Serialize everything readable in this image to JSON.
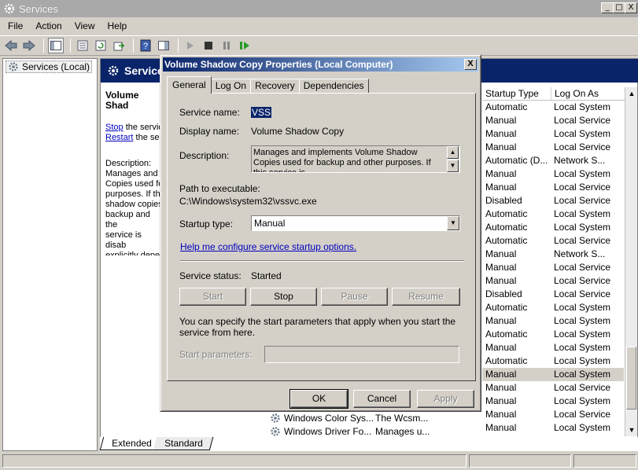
{
  "window": {
    "title": "Services",
    "controls": {
      "minimize": "_",
      "restore": "□",
      "close": "X"
    }
  },
  "menu": [
    "File",
    "Action",
    "View",
    "Help"
  ],
  "tree": {
    "root_label": "Services (Local)"
  },
  "right_pane": {
    "header_title": "Service",
    "description_title": "Volume Shad",
    "stop_link": "Stop",
    "stop_rest": " the servic",
    "restart_link": "Restart",
    "restart_rest": " the se",
    "description_label": "Description:",
    "description_text": "Manages and i\nCopies used fo\npurposes. If th\nshadow copies\nbackup and the\nservice is disab\nexplicitly depe"
  },
  "columns": {
    "startup_type": "Startup Type",
    "log_on_as": "Log On As"
  },
  "services": [
    {
      "startup": "Automatic",
      "logon": "Local System"
    },
    {
      "startup": "Manual",
      "logon": "Local Service"
    },
    {
      "startup": "Manual",
      "logon": "Local System"
    },
    {
      "startup": "Manual",
      "logon": "Local Service"
    },
    {
      "startup": "Automatic (D...",
      "logon": "Network S..."
    },
    {
      "startup": "Manual",
      "logon": "Local System"
    },
    {
      "startup": "Manual",
      "logon": "Local Service"
    },
    {
      "startup": "Disabled",
      "logon": "Local Service"
    },
    {
      "startup": "Automatic",
      "logon": "Local System"
    },
    {
      "startup": "Automatic",
      "logon": "Local System"
    },
    {
      "startup": "Automatic",
      "logon": "Local Service"
    },
    {
      "startup": "Manual",
      "logon": "Network S..."
    },
    {
      "startup": "Manual",
      "logon": "Local Service"
    },
    {
      "startup": "Manual",
      "logon": "Local Service"
    },
    {
      "startup": "Disabled",
      "logon": "Local Service"
    },
    {
      "startup": "Automatic",
      "logon": "Local System"
    },
    {
      "startup": "Manual",
      "logon": "Local System"
    },
    {
      "startup": "Automatic",
      "logon": "Local System"
    },
    {
      "startup": "Manual",
      "logon": "Local System"
    },
    {
      "startup": "Automatic",
      "logon": "Local System"
    },
    {
      "startup": "Manual",
      "logon": "Local System"
    },
    {
      "startup": "Manual",
      "logon": "Local Service"
    },
    {
      "startup": "Manual",
      "logon": "Local System"
    },
    {
      "startup": "Manual",
      "logon": "Local Service"
    },
    {
      "startup": "Manual",
      "logon": "Local System"
    }
  ],
  "selected_service_index": 20,
  "bottom_rows": [
    {
      "name": "Windows Color Sys...",
      "desc": "The Wcsm..."
    },
    {
      "name": "Windows Driver Fo...",
      "desc": "Manages u..."
    }
  ],
  "bottom_tabs": {
    "extended": "Extended",
    "standard": "Standard"
  },
  "dialog": {
    "title": "Volume Shadow Copy Properties (Local Computer)",
    "close": "X",
    "tabs": [
      "General",
      "Log On",
      "Recovery",
      "Dependencies"
    ],
    "service_name_label": "Service name:",
    "service_name_value": "VSS",
    "display_name_label": "Display name:",
    "display_name_value": "Volume Shadow Copy",
    "description_label": "Description:",
    "description_value": "Manages and implements Volume Shadow Copies used for backup and other purposes. If this service is",
    "path_label": "Path to executable:",
    "path_value": "C:\\Windows\\system32\\vssvc.exe",
    "startup_type_label": "Startup type:",
    "startup_type_value": "Manual",
    "help_link": "Help me configure service startup options.",
    "status_label": "Service status:",
    "status_value": "Started",
    "buttons": {
      "start": "Start",
      "stop": "Stop",
      "pause": "Pause",
      "resume": "Resume"
    },
    "params_note": "You can specify the start parameters that apply when you start the service from here.",
    "start_params_label": "Start parameters:",
    "start_params_value": "",
    "ok": "OK",
    "cancel": "Cancel",
    "apply": "Apply"
  }
}
